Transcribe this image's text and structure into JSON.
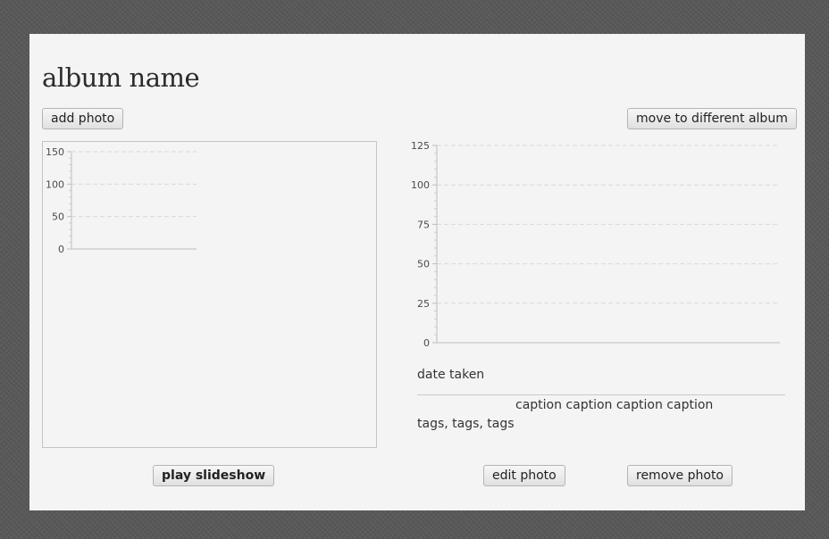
{
  "album": {
    "name": "album name"
  },
  "toolbar": {
    "add_photo": "add photo",
    "move_album": "move to different album"
  },
  "left_chart": {
    "ticks": [
      "0",
      "50",
      "100",
      "150"
    ],
    "ylim": [
      0,
      150
    ]
  },
  "right_chart": {
    "ticks": [
      "0",
      "25",
      "50",
      "75",
      "100",
      "125"
    ],
    "ylim": [
      0,
      125
    ]
  },
  "chart_data": [
    {
      "type": "bar",
      "categories": [],
      "values": [],
      "ylim": [
        0,
        150
      ],
      "yticks": [
        0,
        50,
        100,
        150
      ],
      "grid": true
    },
    {
      "type": "bar",
      "categories": [],
      "values": [],
      "ylim": [
        0,
        125
      ],
      "yticks": [
        0,
        25,
        50,
        75,
        100,
        125
      ],
      "grid": true
    }
  ],
  "details": {
    "date_taken": "date taken",
    "caption": "caption caption caption caption",
    "tags": "tags, tags, tags"
  },
  "actions": {
    "play_slideshow": "play slideshow",
    "edit_photo": "edit photo",
    "remove_photo": "remove photo"
  }
}
